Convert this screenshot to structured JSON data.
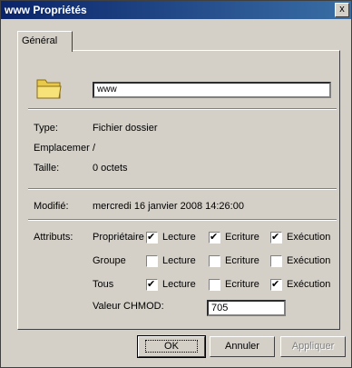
{
  "window": {
    "title": "www Propriétés",
    "close_label": "x"
  },
  "tabs": [
    {
      "label": "Général"
    }
  ],
  "name_value": "www",
  "info": {
    "type_label": "Type:",
    "type_value": "Fichier dossier",
    "location_label": "Emplacemer",
    "location_value": "/",
    "size_label": "Taille:",
    "size_value": "0 octets",
    "modified_label": "Modifié:",
    "modified_value": "mercredi 16 janvier 2008 14:26:00"
  },
  "attributes": {
    "label": "Attributs:",
    "columns": [
      "Lecture",
      "Ecriture",
      "Exécution"
    ],
    "rows": [
      {
        "name": "Propriétaire",
        "checks": [
          true,
          true,
          true
        ]
      },
      {
        "name": "Groupe",
        "checks": [
          false,
          false,
          false
        ]
      },
      {
        "name": "Tous",
        "checks": [
          true,
          false,
          true
        ]
      }
    ],
    "chmod_label": "Valeur CHMOD:",
    "chmod_value": "705"
  },
  "buttons": {
    "ok": "OK",
    "cancel": "Annuler",
    "apply": "Appliquer"
  }
}
